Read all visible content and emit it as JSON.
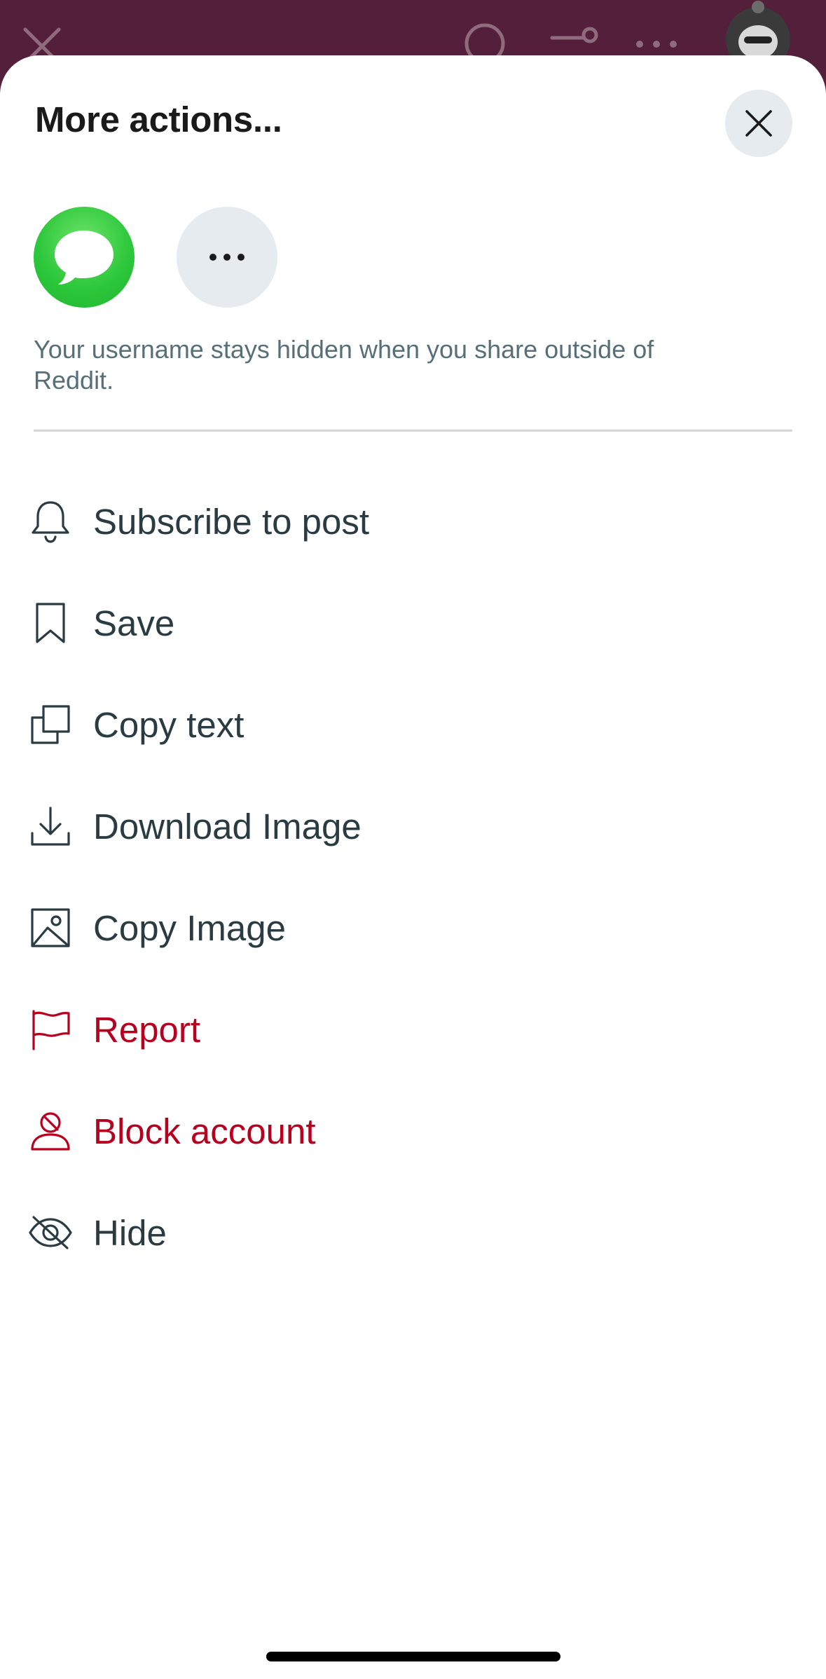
{
  "sheet": {
    "title": "More actions...",
    "share_targets": [
      {
        "name": "messages",
        "icon": "message-bubble-icon",
        "color": "#34c759"
      },
      {
        "name": "more",
        "icon": "ellipsis-icon"
      }
    ],
    "privacy_note": "Your username stays hidden when you share outside of Reddit.",
    "menu": [
      {
        "label": "Subscribe to post",
        "icon": "bell-icon",
        "danger": false
      },
      {
        "label": "Save",
        "icon": "bookmark-icon",
        "danger": false
      },
      {
        "label": "Copy text",
        "icon": "copy-icon",
        "danger": false
      },
      {
        "label": "Download Image",
        "icon": "download-icon",
        "danger": false
      },
      {
        "label": "Copy Image",
        "icon": "image-icon",
        "danger": false
      },
      {
        "label": "Report",
        "icon": "flag-icon",
        "danger": true
      },
      {
        "label": "Block account",
        "icon": "person-icon",
        "danger": true
      },
      {
        "label": "Hide",
        "icon": "eye-off-icon",
        "danger": false
      }
    ]
  },
  "colors": {
    "background_header": "#541f3a",
    "text_primary": "#2a3c42",
    "text_secondary": "#576f76",
    "danger": "#b8001f",
    "button_bg": "#e5ebee"
  }
}
